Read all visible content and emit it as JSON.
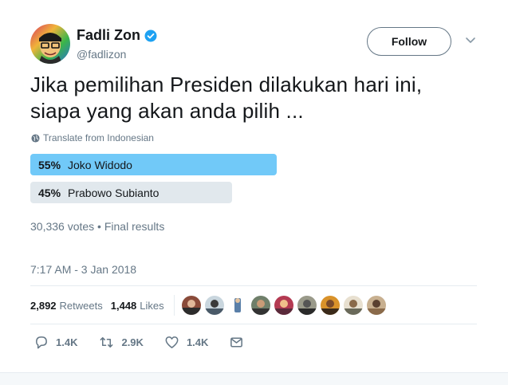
{
  "author": {
    "name": "Fadli Zon",
    "handle": "@fadlizon",
    "verified_icon": "verified-badge-icon",
    "avatar_icon": "profile-avatar"
  },
  "follow_label": "Follow",
  "tweet": {
    "line1": "Jika pemilihan Presiden dilakukan hari ini,",
    "line2": "siapa yang akan anda pilih ..."
  },
  "translate_label": "Translate from Indonesian",
  "poll": {
    "options": [
      {
        "percent": "55%",
        "label": "Joko Widodo",
        "share": 0.55,
        "winner": true
      },
      {
        "percent": "45%",
        "label": "Prabowo Subianto",
        "share": 0.45,
        "winner": false
      }
    ],
    "summary": "30,336 votes • Final results"
  },
  "timestamp": "7:17 AM - 3 Jan 2018",
  "stats": {
    "retweets_count": "2,892",
    "retweets_label": "Retweets",
    "likes_count": "1,448",
    "likes_label": "Likes"
  },
  "actions": {
    "reply_count": "1.4K",
    "retweet_count": "2.9K",
    "like_count": "1.4K"
  },
  "colors": {
    "poll_winner": "#71c9f8",
    "poll_other": "#e1e8ed",
    "verified": "#1da1f2",
    "muted_text": "#657786"
  }
}
